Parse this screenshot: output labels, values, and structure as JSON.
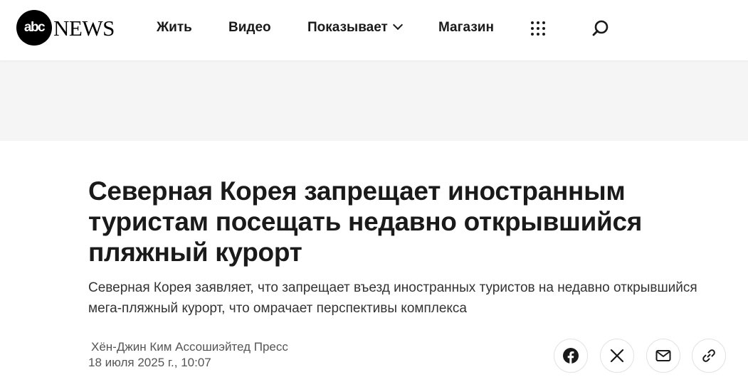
{
  "header": {
    "logo": {
      "badge_text": "abc",
      "word_text": "NEWS"
    },
    "nav": [
      {
        "label": "Жить"
      },
      {
        "label": "Видео"
      },
      {
        "label": "Показывает",
        "has_dropdown": true
      },
      {
        "label": "Магазин"
      }
    ],
    "icons": {
      "menu": "grid-dots-icon",
      "search": "search-icon"
    }
  },
  "article": {
    "headline": "Северная Корея запрещает иностранным туристам посещать недавно открывшийся пляжный курорт",
    "subheadline": "Северная Корея заявляет, что запрещает въезд иностранных туристов на недавно открывшийся мега-пляжный курорт, что омрачает перспективы комплекса",
    "byline": "Хён-Джин Ким Ассошиэйтед Пресс",
    "date": "18 июля 2025 г., 10:07"
  },
  "share": {
    "buttons": [
      "facebook-icon",
      "x-icon",
      "email-icon",
      "link-icon"
    ]
  },
  "colors": {
    "text": "#1a1a1a",
    "muted": "#555555",
    "ad_background": "#f5f5f5",
    "border": "#e2e2e2"
  }
}
